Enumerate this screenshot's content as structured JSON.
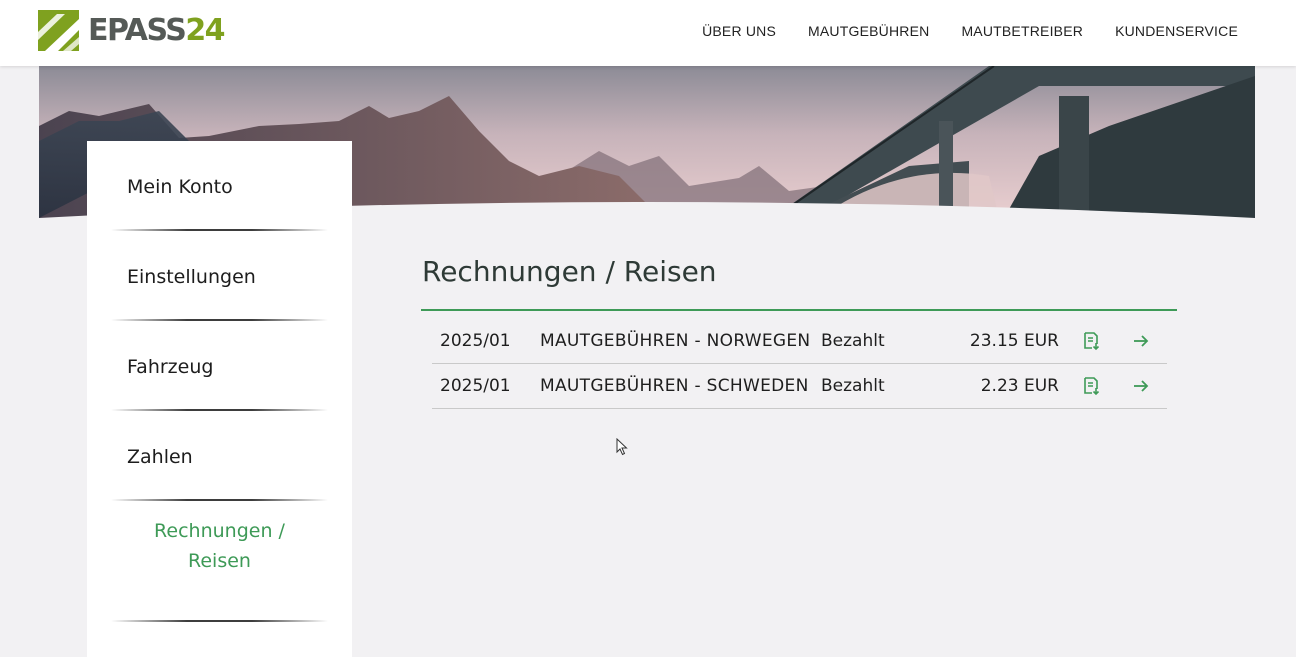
{
  "brand": {
    "name_part1": "EPASS",
    "name_part2": "24",
    "logo_icon": "epass24-logo-icon"
  },
  "nav": {
    "items": [
      "ÜBER UNS",
      "MAUTGEBÜHREN",
      "MAUTBETREIBER",
      "KUNDENSERVICE"
    ]
  },
  "sidebar": {
    "items": [
      {
        "label": "Mein Konto"
      },
      {
        "label": "Einstellungen"
      },
      {
        "label": "Fahrzeug"
      },
      {
        "label": "Zahlen"
      },
      {
        "label": "Rechnungen / Reisen",
        "active": true
      }
    ]
  },
  "main": {
    "title": "Rechnungen / Reisen",
    "rows": [
      {
        "period": "2025/01",
        "description": "MAUTGEBÜHREN - NORWEGEN",
        "status": "Bezahlt",
        "amount": "23.15 EUR",
        "doc_icon": "invoice-download-icon",
        "go_icon": "arrow-right-icon"
      },
      {
        "period": "2025/01",
        "description": "MAUTGEBÜHREN - SCHWEDEN",
        "status": "Bezahlt",
        "amount": "2.23 EUR",
        "doc_icon": "invoice-download-icon",
        "go_icon": "arrow-right-icon"
      }
    ]
  },
  "colors": {
    "accent": "#3e9a57",
    "brand_green": "#7fa11f",
    "brand_grey": "#555a57",
    "background": "#f2f1f3"
  }
}
